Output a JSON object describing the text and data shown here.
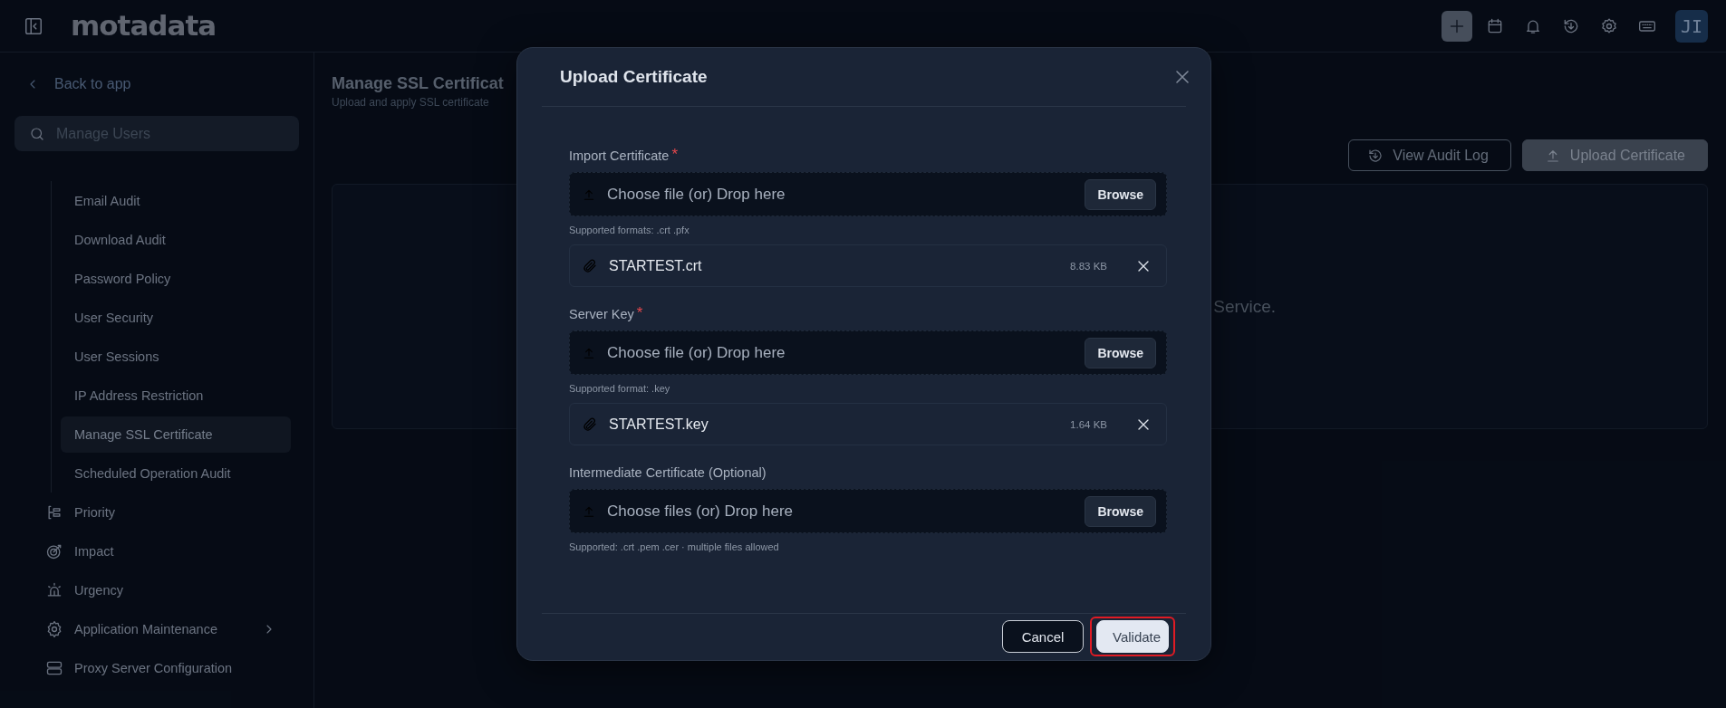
{
  "header": {
    "logo": "motadata",
    "avatar": "JI"
  },
  "sidebar": {
    "back_label": "Back to app",
    "search": {
      "placeholder": "Manage Users"
    },
    "items": [
      {
        "label": "Email Audit",
        "kind": "sub",
        "selected": false
      },
      {
        "label": "Download Audit",
        "kind": "sub",
        "selected": false
      },
      {
        "label": "Password Policy",
        "kind": "sub",
        "selected": false
      },
      {
        "label": "User Security",
        "kind": "sub",
        "selected": false
      },
      {
        "label": "User Sessions",
        "kind": "sub",
        "selected": false
      },
      {
        "label": "IP Address Restriction",
        "kind": "sub",
        "selected": false
      },
      {
        "label": "Manage SSL Certificate",
        "kind": "sub",
        "selected": true
      },
      {
        "label": "Scheduled Operation Audit",
        "kind": "sub",
        "selected": false
      },
      {
        "label": "Priority",
        "kind": "top",
        "selected": false,
        "expandable": false
      },
      {
        "label": "Impact",
        "kind": "top",
        "selected": false,
        "expandable": false
      },
      {
        "label": "Urgency",
        "kind": "top",
        "selected": false,
        "expandable": false
      },
      {
        "label": "Application Maintenance",
        "kind": "top",
        "selected": false,
        "expandable": true
      },
      {
        "label": "Proxy Server Configuration",
        "kind": "top",
        "selected": false,
        "expandable": false
      }
    ]
  },
  "page": {
    "title": "Manage SSL Certificat",
    "subtitle": "Upload and apply SSL certificate",
    "buttons": [
      {
        "label": "View Audit Log",
        "kind": "outline"
      },
      {
        "label": "Upload Certificate",
        "kind": "filled"
      }
    ],
    "card_text": "Service."
  },
  "modal": {
    "title": "Upload Certificate",
    "sections": [
      {
        "label": "Import Certificate",
        "required_mark": "*",
        "dropzone": "Choose file (or) Drop here",
        "browse": "Browse",
        "hint": "Supported formats: .crt .pfx",
        "file": {
          "name": "STARTEST.crt",
          "size": "8.83 KB"
        }
      },
      {
        "label": "Server Key",
        "required_mark": "*",
        "dropzone": "Choose file (or) Drop here",
        "browse": "Browse",
        "hint": "Supported format: .key",
        "file": {
          "name": "STARTEST.key",
          "size": "1.64 KB"
        }
      },
      {
        "label": "Intermediate Certificate (Optional)",
        "dropzone": "Choose files (or) Drop here",
        "browse": "Browse",
        "hint": "Supported: .crt .pem .cer · multiple files allowed"
      }
    ],
    "buttons": [
      {
        "label": "Cancel",
        "kind": "secondary",
        "highlighted": false
      },
      {
        "label": "Validate",
        "kind": "primary",
        "highlighted": true
      }
    ]
  }
}
